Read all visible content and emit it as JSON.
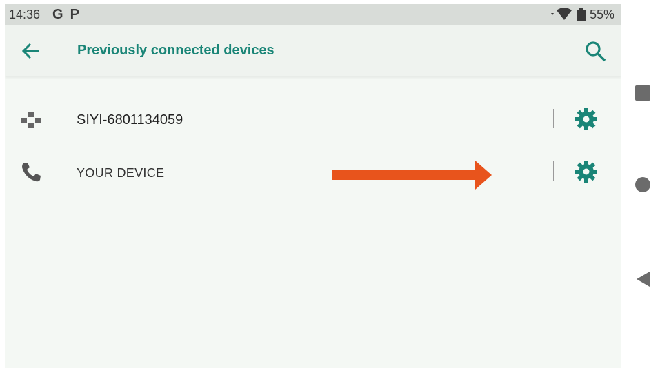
{
  "status_bar": {
    "time": "14:36",
    "g_icon_label": "G",
    "p_icon_label": "P",
    "battery": "55%"
  },
  "app_bar": {
    "title": "Previously connected devices"
  },
  "devices": [
    {
      "name": "SIYI-6801134059",
      "icon": "gamepad-icon"
    },
    {
      "name": "YOUR DEVICE",
      "icon": "phone-icon"
    }
  ],
  "colors": {
    "accent": "#1a8577",
    "annotation_arrow": "#e8541c",
    "background": "#f4f8f4"
  }
}
